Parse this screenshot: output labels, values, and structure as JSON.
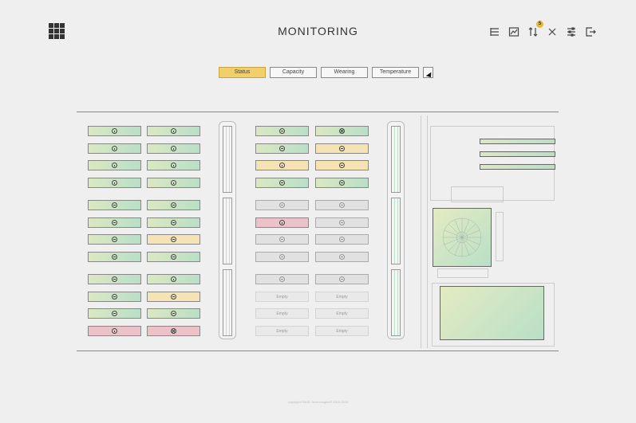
{
  "header": {
    "title": "MONITORING",
    "badge_count": "5",
    "toolbar": [
      {
        "name": "list-icon-button",
        "icon": "list-icon"
      },
      {
        "name": "chart-icon-button",
        "icon": "chart-icon"
      },
      {
        "name": "sort-icon-button",
        "icon": "sort-icon"
      },
      {
        "name": "close-icon-button",
        "icon": "close-icon"
      },
      {
        "name": "sliders-icon-button",
        "icon": "sliders-icon"
      },
      {
        "name": "logout-icon-button",
        "icon": "logout-icon"
      }
    ]
  },
  "tabs": [
    {
      "label": "Status",
      "active": true
    },
    {
      "label": "Capacity",
      "active": false
    },
    {
      "label": "Wearing",
      "active": false
    },
    {
      "label": "Temperature",
      "active": false
    },
    {
      "label": "",
      "active": false
    }
  ],
  "grid_left": [
    [
      "green",
      "drop",
      "green",
      "drop"
    ],
    [
      "green",
      "drop",
      "green",
      "drop"
    ],
    [
      "green",
      "drop",
      "green",
      "drop"
    ],
    [
      "green",
      "drop",
      "green",
      "drop"
    ],
    [
      "green",
      "dash",
      "green",
      "dash"
    ],
    [
      "green",
      "dash",
      "green",
      "dash"
    ],
    [
      "green",
      "dash",
      "yellow",
      "dash"
    ],
    [
      "green",
      "dash",
      "green",
      "dash"
    ],
    [
      "green",
      "dash",
      "green",
      "drop"
    ],
    [
      "green",
      "dash",
      "yellow",
      "dash"
    ],
    [
      "green",
      "dash",
      "green",
      "dash"
    ],
    [
      "red",
      "drop",
      "red",
      "xmark"
    ]
  ],
  "grid_mid": [
    [
      "green",
      "dash",
      "green",
      "xmark"
    ],
    [
      "green",
      "dash",
      "yellow",
      "dash"
    ],
    [
      "yellow",
      "drop",
      "yellow",
      "dash"
    ],
    [
      "green",
      "dash",
      "green",
      "dash"
    ],
    [
      "grey",
      "dash",
      "grey",
      "dash"
    ],
    [
      "red",
      "drop",
      "grey",
      "dash"
    ],
    [
      "grey",
      "dash",
      "grey",
      "dash"
    ],
    [
      "grey",
      "dash",
      "grey",
      "dash"
    ],
    [
      "grey",
      "dash",
      "grey",
      "dash"
    ],
    [
      "empty",
      "Empty",
      "empty",
      "Empty"
    ],
    [
      "empty",
      "Empty",
      "empty",
      "Empty"
    ],
    [
      "empty",
      "Empty",
      "empty",
      "Empty"
    ]
  ],
  "footer": "copyright PAUD Technologies® 2015-2016",
  "colors": {
    "accent": "#f2cf6d",
    "green": "#b9dfc7",
    "red": "#ebc2c8"
  }
}
